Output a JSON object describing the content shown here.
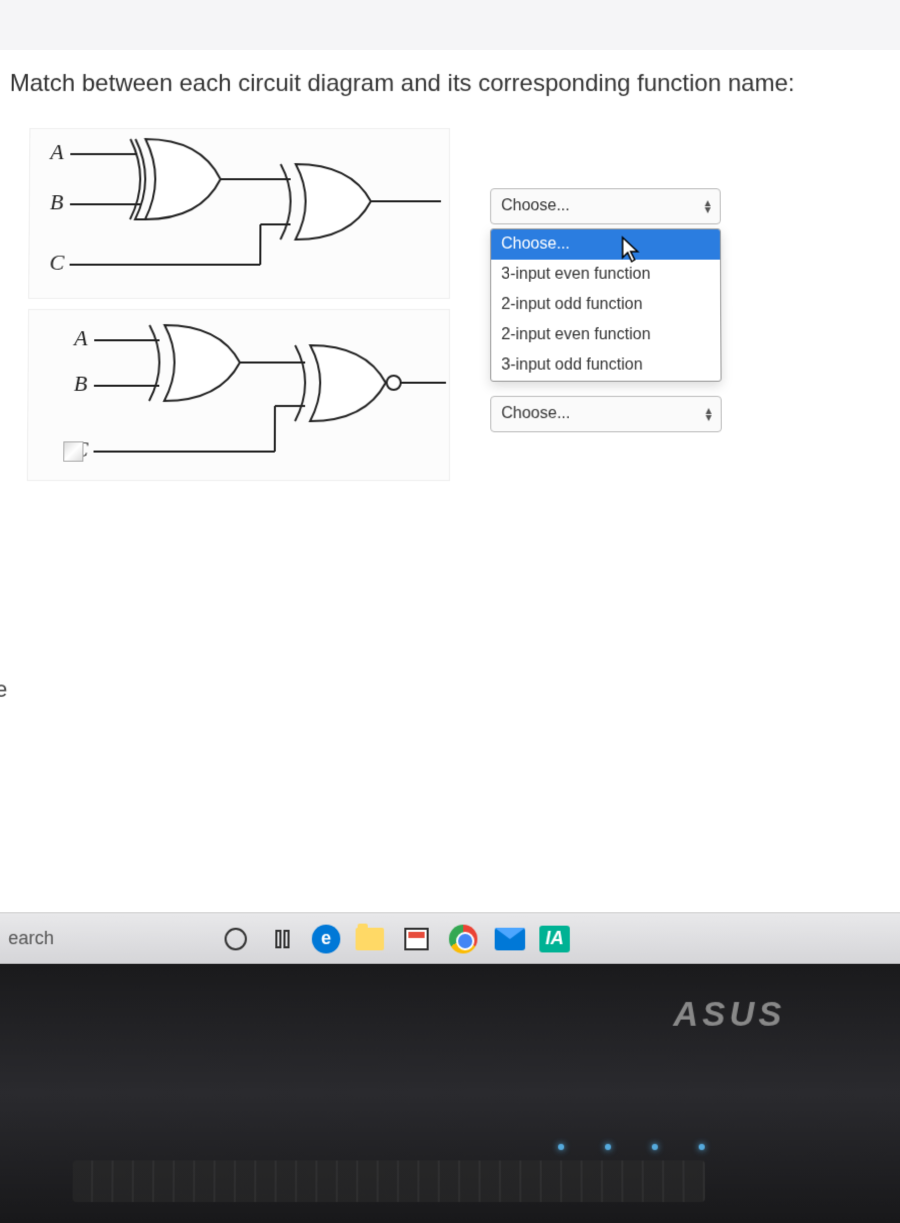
{
  "question": {
    "prompt": "Match between each circuit diagram and its corresponding function name:"
  },
  "circuits": [
    {
      "inputs": [
        "A",
        "B",
        "C"
      ]
    },
    {
      "inputs": [
        "A",
        "B",
        "C"
      ]
    }
  ],
  "dropdown": {
    "placeholder": "Choose...",
    "open_index": 0,
    "options": [
      "Choose...",
      "3-input even function",
      "2-input odd function",
      "2-input even function",
      "3-input odd function"
    ]
  },
  "selects": [
    {
      "value": "Choose..."
    },
    {
      "value": "Choose..."
    }
  ],
  "left_fragment": "e",
  "taskbar": {
    "search_label": "earch",
    "app_label": "IA"
  },
  "monitor": {
    "brand": "ASUS"
  }
}
